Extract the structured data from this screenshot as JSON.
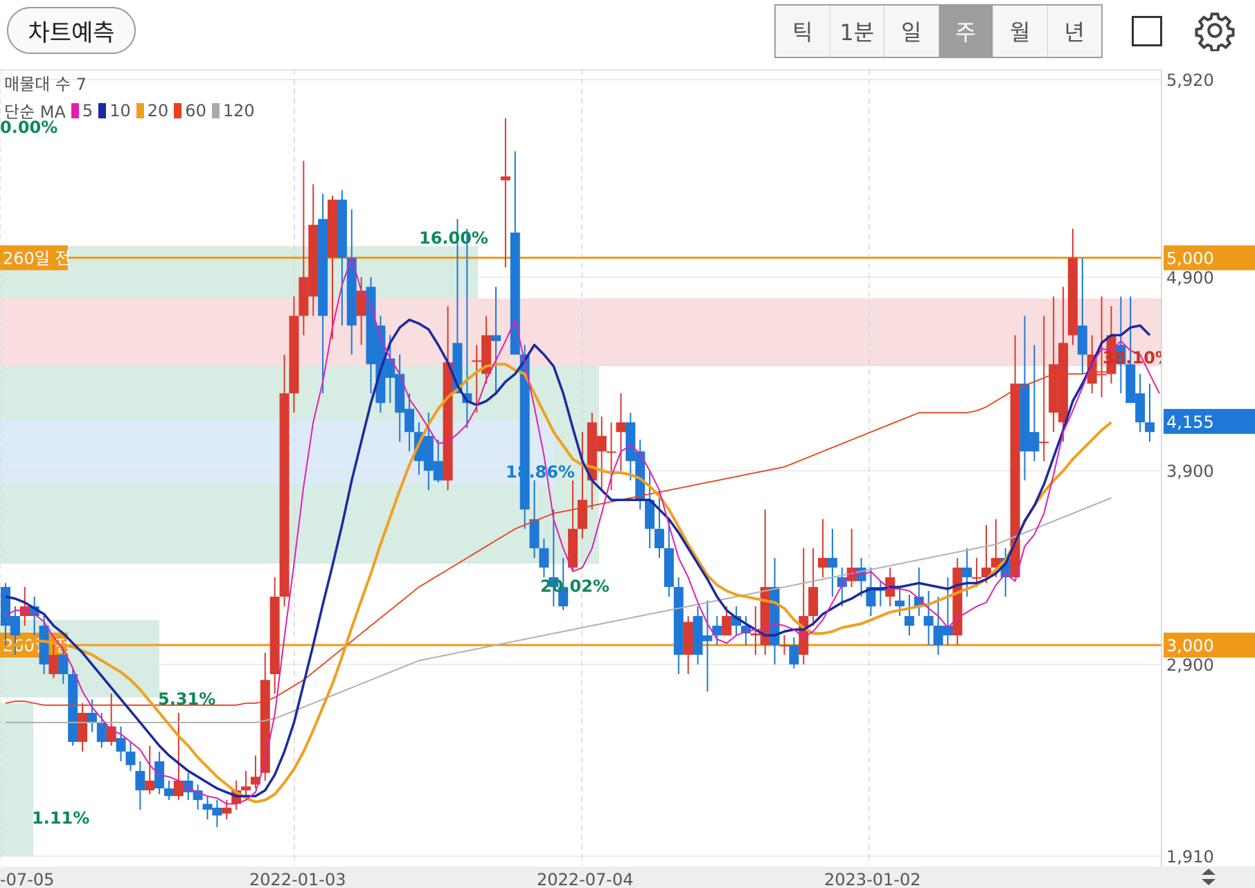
{
  "toolbar": {
    "predict_label": "차트예측",
    "periods": [
      "틱",
      "1분",
      "일",
      "주",
      "월",
      "년"
    ],
    "active_period": "주"
  },
  "legend": {
    "volume_profile": "매물대 수 7",
    "ma_label": "단순 MA",
    "ma_items": [
      {
        "period": "5",
        "color": "#e020b0"
      },
      {
        "period": "10",
        "color": "#1a2aa0"
      },
      {
        "period": "20",
        "color": "#f0a020"
      },
      {
        "period": "60",
        "color": "#e8401a"
      },
      {
        "period": "120",
        "color": "#aaaaaa"
      }
    ],
    "top_pct": "0.00%"
  },
  "chart_data": {
    "type": "candlestick",
    "y_axis": {
      "min": 1910,
      "max": 5920,
      "ticks": [
        5920,
        4900,
        3900,
        2900,
        1910
      ]
    },
    "x_ticks": [
      "-07-05",
      "2022-01-03",
      "2022-07-04",
      "2023-01-02"
    ],
    "current_price": "4,155",
    "reference_lines": [
      {
        "label": "260일 전",
        "value": 5000,
        "value_label": "5,000"
      },
      {
        "label": "260일 전",
        "value": 3000,
        "value_label": "3,000"
      }
    ],
    "zone_labels": [
      {
        "text": "16.00%",
        "color": "#0d8a5a"
      },
      {
        "text": "18.86%",
        "color": "#1a7fd0"
      },
      {
        "text": "20.02%",
        "color": "#0d8a5a"
      },
      {
        "text": "5.31%",
        "color": "#0d8a5a"
      },
      {
        "text": "1.11%",
        "color": "#0d8a5a"
      },
      {
        "text": "38.10%",
        "color": "#d03020"
      }
    ],
    "candles": [
      [
        3300,
        3100,
        3320,
        3000
      ],
      [
        3150,
        3050,
        3200,
        2950
      ],
      [
        3150,
        3200,
        3300,
        3100
      ],
      [
        3200,
        3150,
        3250,
        3050
      ],
      [
        3100,
        2900,
        3150,
        2850
      ],
      [
        2850,
        2950,
        3020,
        2830
      ],
      [
        2950,
        2850,
        2980,
        2800
      ],
      [
        2850,
        2500,
        2880,
        2480
      ],
      [
        2500,
        2650,
        2700,
        2450
      ],
      [
        2650,
        2600,
        2720,
        2550
      ],
      [
        2600,
        2500,
        2650,
        2470
      ],
      [
        2500,
        2580,
        2750,
        2480
      ],
      [
        2520,
        2450,
        2580,
        2400
      ],
      [
        2450,
        2380,
        2500,
        2350
      ],
      [
        2350,
        2250,
        2400,
        2150
      ],
      [
        2250,
        2300,
        2480,
        2230
      ],
      [
        2400,
        2260,
        2450,
        2230
      ],
      [
        2260,
        2220,
        2300,
        2200
      ],
      [
        2220,
        2300,
        2650,
        2200
      ],
      [
        2300,
        2240,
        2340,
        2200
      ],
      [
        2250,
        2200,
        2280,
        2150
      ],
      [
        2180,
        2150,
        2220,
        2100
      ],
      [
        2160,
        2120,
        2200,
        2060
      ],
      [
        2130,
        2160,
        2200,
        2100
      ],
      [
        2180,
        2250,
        2300,
        2150
      ],
      [
        2250,
        2270,
        2350,
        2220
      ],
      [
        2280,
        2320,
        2430,
        2260
      ],
      [
        2340,
        2820,
        2960,
        2300
      ],
      [
        2850,
        3250,
        3350,
        2750
      ],
      [
        3250,
        4300,
        4500,
        3200
      ],
      [
        4300,
        4700,
        4800,
        4200
      ],
      [
        4700,
        4900,
        5500,
        4600
      ],
      [
        4800,
        5170,
        5380,
        4700
      ],
      [
        5200,
        4700,
        5330,
        4300
      ],
      [
        5000,
        5300,
        5320,
        4580
      ],
      [
        5300,
        5000,
        5350,
        4650
      ],
      [
        5000,
        4650,
        5250,
        4500
      ],
      [
        4700,
        4830,
        4900,
        4550
      ],
      [
        4850,
        4450,
        4900,
        4300
      ],
      [
        4650,
        4250,
        4700,
        4200
      ],
      [
        4480,
        4380,
        4600,
        4250
      ],
      [
        4400,
        4200,
        4500,
        4050
      ],
      [
        4220,
        4100,
        4300,
        4000
      ],
      [
        4100,
        3950,
        4150,
        3880
      ],
      [
        4080,
        3900,
        4200,
        3800
      ],
      [
        3950,
        3850,
        4060,
        3840
      ],
      [
        3850,
        4460,
        4750,
        3800
      ],
      [
        4560,
        4300,
        5200,
        4300
      ],
      [
        4300,
        4250,
        5150,
        4120
      ],
      [
        4470,
        4470,
        4550,
        4200
      ],
      [
        4400,
        4600,
        4700,
        4350
      ],
      [
        4600,
        4570,
        4850,
        4300
      ],
      [
        5400,
        5420,
        5720,
        4950
      ],
      [
        5130,
        4500,
        5550,
        4500
      ],
      [
        4500,
        3700,
        4550,
        3600
      ],
      [
        3650,
        3500,
        3850,
        3450
      ],
      [
        3500,
        3400,
        3550,
        3350
      ],
      [
        3350,
        3300,
        3700,
        3200
      ],
      [
        3300,
        3200,
        3450,
        3180
      ],
      [
        3400,
        3600,
        3850,
        3380
      ],
      [
        3600,
        3750,
        4100,
        3550
      ],
      [
        3850,
        4150,
        4200,
        3700
      ],
      [
        4000,
        4080,
        4180,
        3800
      ],
      [
        4000,
        4000,
        4150,
        3800
      ],
      [
        4100,
        4150,
        4300,
        3900
      ],
      [
        4150,
        3950,
        4200,
        3850
      ],
      [
        4000,
        3750,
        4060,
        3700
      ],
      [
        3750,
        3600,
        3900,
        3500
      ],
      [
        3600,
        3500,
        3800,
        3450
      ],
      [
        3500,
        3300,
        3650,
        3250
      ],
      [
        3300,
        2950,
        3350,
        2850
      ],
      [
        2950,
        3120,
        3150,
        2850
      ],
      [
        3150,
        2950,
        3200,
        2900
      ],
      [
        3050,
        3020,
        3230,
        2760
      ],
      [
        3100,
        3050,
        3150,
        3000
      ],
      [
        3050,
        3150,
        3200,
        3050
      ],
      [
        3150,
        3100,
        3200,
        3050
      ],
      [
        3100,
        3060,
        3150,
        3000
      ],
      [
        3050,
        3060,
        3200,
        2950
      ],
      [
        3000,
        3300,
        3700,
        2950
      ],
      [
        3300,
        3000,
        3450,
        2900
      ],
      [
        3000,
        3000,
        3050,
        2950
      ],
      [
        3000,
        2900,
        3040,
        2880
      ],
      [
        2950,
        3150,
        3500,
        2900
      ],
      [
        3150,
        3300,
        3500,
        3100
      ],
      [
        3400,
        3450,
        3650,
        3350
      ],
      [
        3450,
        3400,
        3600,
        3250
      ],
      [
        3350,
        3300,
        3400,
        3200
      ],
      [
        3330,
        3400,
        3600,
        3300
      ],
      [
        3400,
        3330,
        3450,
        3250
      ],
      [
        3300,
        3200,
        3400,
        3150
      ],
      [
        3300,
        3280,
        3330,
        3200
      ],
      [
        3250,
        3350,
        3400,
        3200
      ],
      [
        3230,
        3200,
        3300,
        3150
      ],
      [
        3150,
        3100,
        3260,
        3050
      ],
      [
        3250,
        3200,
        3400,
        3150
      ],
      [
        3150,
        3100,
        3280,
        3000
      ],
      [
        3100,
        3000,
        3250,
        2950
      ],
      [
        3100,
        3050,
        3350,
        3000
      ],
      [
        3050,
        3400,
        3450,
        3000
      ],
      [
        3400,
        3350,
        3500,
        3250
      ],
      [
        3350,
        3350,
        3450,
        3300
      ],
      [
        3350,
        3400,
        3620,
        3320
      ],
      [
        3400,
        3450,
        3650,
        3350
      ],
      [
        3450,
        3350,
        3500,
        3250
      ],
      [
        3350,
        4350,
        4600,
        3350
      ],
      [
        4350,
        4000,
        4700,
        3850
      ],
      [
        4100,
        4000,
        4550,
        3950
      ],
      [
        4050,
        4050,
        4700,
        3950
      ],
      [
        4200,
        4450,
        4800,
        4100
      ],
      [
        4150,
        4560,
        4850,
        4050
      ],
      [
        4600,
        5000,
        5150,
        4550
      ],
      [
        4650,
        4500,
        5000,
        4400
      ],
      [
        4350,
        4500,
        4600,
        4300
      ],
      [
        4400,
        4400,
        4800,
        4280
      ],
      [
        4400,
        4600,
        4750,
        4350
      ],
      [
        4550,
        4450,
        4800,
        4300
      ],
      [
        4450,
        4250,
        4800,
        4250
      ],
      [
        4300,
        4150,
        4400,
        4100
      ],
      [
        4150,
        4100,
        4350,
        4050
      ]
    ],
    "ma5": [
      3150,
      3180,
      3180,
      3160,
      3120,
      3040,
      2980,
      2880,
      2760,
      2680,
      2620,
      2560,
      2540,
      2500,
      2460,
      2380,
      2330,
      2320,
      2300,
      2260,
      2240,
      2220,
      2210,
      2180,
      2180,
      2200,
      2240,
      2400,
      2640,
      3040,
      3420,
      3820,
      4150,
      4360,
      4640,
      4860,
      5000,
      4830,
      4750,
      4590,
      4480,
      4400,
      4270,
      4200,
      4120,
      4040,
      4050,
      4090,
      4140,
      4230,
      4370,
      4470,
      4570,
      4680,
      4460,
      4230,
      3980,
      3650,
      3500,
      3380,
      3400,
      3500,
      3680,
      3870,
      4000,
      4030,
      3990,
      3900,
      3800,
      3620,
      3450,
      3350,
      3220,
      3110,
      3030,
      3010,
      3050,
      3070,
      3080,
      3080,
      3110,
      3100,
      3080,
      3040,
      3070,
      3130,
      3220,
      3310,
      3380,
      3360,
      3380,
      3330,
      3290,
      3290,
      3280,
      3240,
      3190,
      3150,
      3090,
      3140,
      3170,
      3200,
      3220,
      3310,
      3370,
      3330,
      3510,
      3570,
      3680,
      3880,
      4100,
      4210,
      4330,
      4450,
      4530,
      4520,
      4570,
      4520,
      4500,
      4400,
      4300
    ],
    "ma10": [
      3250,
      3240,
      3220,
      3190,
      3160,
      3100,
      3060,
      3010,
      2960,
      2900,
      2840,
      2780,
      2720,
      2660,
      2600,
      2540,
      2480,
      2430,
      2390,
      2350,
      2320,
      2290,
      2260,
      2240,
      2220,
      2220,
      2220,
      2250,
      2330,
      2450,
      2600,
      2800,
      3000,
      3210,
      3410,
      3620,
      3850,
      4050,
      4250,
      4420,
      4560,
      4640,
      4680,
      4660,
      4630,
      4550,
      4460,
      4340,
      4260,
      4240,
      4260,
      4300,
      4360,
      4400,
      4470,
      4550,
      4500,
      4440,
      4300,
      4120,
      3950,
      3850,
      3800,
      3750,
      3750,
      3750,
      3750,
      3750,
      3700,
      3650,
      3580,
      3500,
      3420,
      3340,
      3250,
      3180,
      3140,
      3110,
      3080,
      3050,
      3050,
      3070,
      3080,
      3080,
      3110,
      3160,
      3190,
      3220,
      3240,
      3270,
      3290,
      3290,
      3300,
      3300,
      3310,
      3320,
      3310,
      3300,
      3290,
      3310,
      3320,
      3320,
      3340,
      3370,
      3420,
      3530,
      3640,
      3720,
      3830,
      3970,
      4110,
      4260,
      4350,
      4450,
      4560,
      4600,
      4600,
      4640,
      4650,
      4600
    ],
    "ma20": [
      2980,
      3000,
      3010,
      3020,
      3020,
      3010,
      3000,
      2990,
      2970,
      2950,
      2920,
      2890,
      2860,
      2820,
      2770,
      2710,
      2650,
      2590,
      2530,
      2480,
      2420,
      2370,
      2320,
      2280,
      2240,
      2210,
      2190,
      2200,
      2230,
      2290,
      2360,
      2450,
      2560,
      2680,
      2800,
      2940,
      3090,
      3230,
      3370,
      3520,
      3660,
      3800,
      3930,
      4040,
      4140,
      4220,
      4280,
      4320,
      4370,
      4410,
      4440,
      4450,
      4450,
      4420,
      4400,
      4300,
      4200,
      4100,
      4030,
      3960,
      3930,
      3920,
      3900,
      3890,
      3890,
      3880,
      3860,
      3820,
      3770,
      3700,
      3610,
      3520,
      3440,
      3360,
      3310,
      3280,
      3260,
      3250,
      3240,
      3230,
      3220,
      3190,
      3130,
      3090,
      3060,
      3060,
      3070,
      3090,
      3100,
      3110,
      3130,
      3150,
      3170,
      3180,
      3190,
      3200,
      3210,
      3230,
      3250,
      3270,
      3290,
      3310,
      3340,
      3390,
      3440,
      3530,
      3640,
      3720,
      3790,
      3850,
      3900,
      3960,
      4010,
      4060,
      4110,
      4150
    ],
    "ma60": [
      2700,
      2710,
      2710,
      2700,
      2690,
      2690,
      2690,
      2690,
      2690,
      2690,
      2690,
      2690,
      2690,
      2690,
      2690,
      2690,
      2690,
      2690,
      2690,
      2690,
      2690,
      2690,
      2690,
      2690,
      2690,
      2700,
      2700,
      2710,
      2730,
      2760,
      2790,
      2820,
      2860,
      2900,
      2940,
      2980,
      3020,
      3060,
      3100,
      3140,
      3180,
      3220,
      3260,
      3300,
      3330,
      3360,
      3390,
      3420,
      3450,
      3480,
      3510,
      3540,
      3570,
      3600,
      3620,
      3640,
      3660,
      3680,
      3690,
      3700,
      3710,
      3720,
      3730,
      3740,
      3750,
      3760,
      3770,
      3780,
      3790,
      3800,
      3810,
      3820,
      3830,
      3840,
      3850,
      3860,
      3870,
      3880,
      3890,
      3900,
      3910,
      3920,
      3940,
      3960,
      3980,
      4000,
      4020,
      4040,
      4060,
      4080,
      4100,
      4120,
      4140,
      4160,
      4180,
      4200,
      4200,
      4200,
      4200,
      4200,
      4200,
      4210,
      4230,
      4260,
      4290,
      4320,
      4340,
      4360,
      4380,
      4400,
      4400,
      4400,
      4400,
      4410,
      4410,
      4410
    ],
    "ma120": [
      2600,
      2600,
      2600,
      2600,
      2600,
      2600,
      2600,
      2600,
      2600,
      2600,
      2600,
      2600,
      2600,
      2600,
      2600,
      2600,
      2600,
      2600,
      2600,
      2600,
      2600,
      2600,
      2600,
      2600,
      2600,
      2600,
      2600,
      2610,
      2620,
      2640,
      2660,
      2680,
      2700,
      2720,
      2740,
      2760,
      2780,
      2800,
      2820,
      2840,
      2860,
      2880,
      2900,
      2920,
      2930,
      2940,
      2950,
      2960,
      2970,
      2980,
      2990,
      3000,
      3010,
      3020,
      3030,
      3040,
      3050,
      3060,
      3070,
      3080,
      3090,
      3100,
      3110,
      3120,
      3130,
      3140,
      3150,
      3160,
      3170,
      3180,
      3190,
      3200,
      3210,
      3220,
      3230,
      3240,
      3250,
      3260,
      3270,
      3280,
      3290,
      3300,
      3310,
      3320,
      3330,
      3340,
      3350,
      3360,
      3370,
      3380,
      3390,
      3400,
      3410,
      3420,
      3430,
      3440,
      3450,
      3460,
      3470,
      3480,
      3490,
      3500,
      3510,
      3520,
      3540,
      3560,
      3580,
      3600,
      3620,
      3640,
      3660,
      3680,
      3700,
      3720,
      3740,
      3760
    ]
  }
}
